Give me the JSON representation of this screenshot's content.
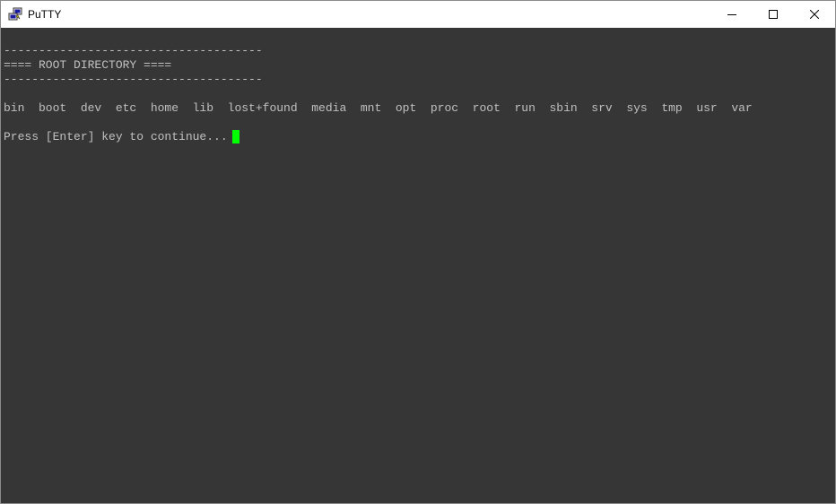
{
  "window": {
    "title": "PuTTY",
    "app_icon": "putty-icon",
    "controls": {
      "minimize_icon": "minimize-icon",
      "maximize_icon": "maximize-icon",
      "close_icon": "close-icon"
    }
  },
  "terminal": {
    "background": "#363636",
    "foreground": "#c0c0c0",
    "cursor_color": "#00ff00",
    "lines": {
      "separator_top": "-------------------------------------",
      "heading": "==== ROOT DIRECTORY ====",
      "separator_bottom": "-------------------------------------",
      "listing": "bin  boot  dev  etc  home  lib  lost+found  media  mnt  opt  proc  root  run  sbin  srv  sys  tmp  usr  var",
      "prompt": "Press [Enter] key to continue..."
    }
  }
}
